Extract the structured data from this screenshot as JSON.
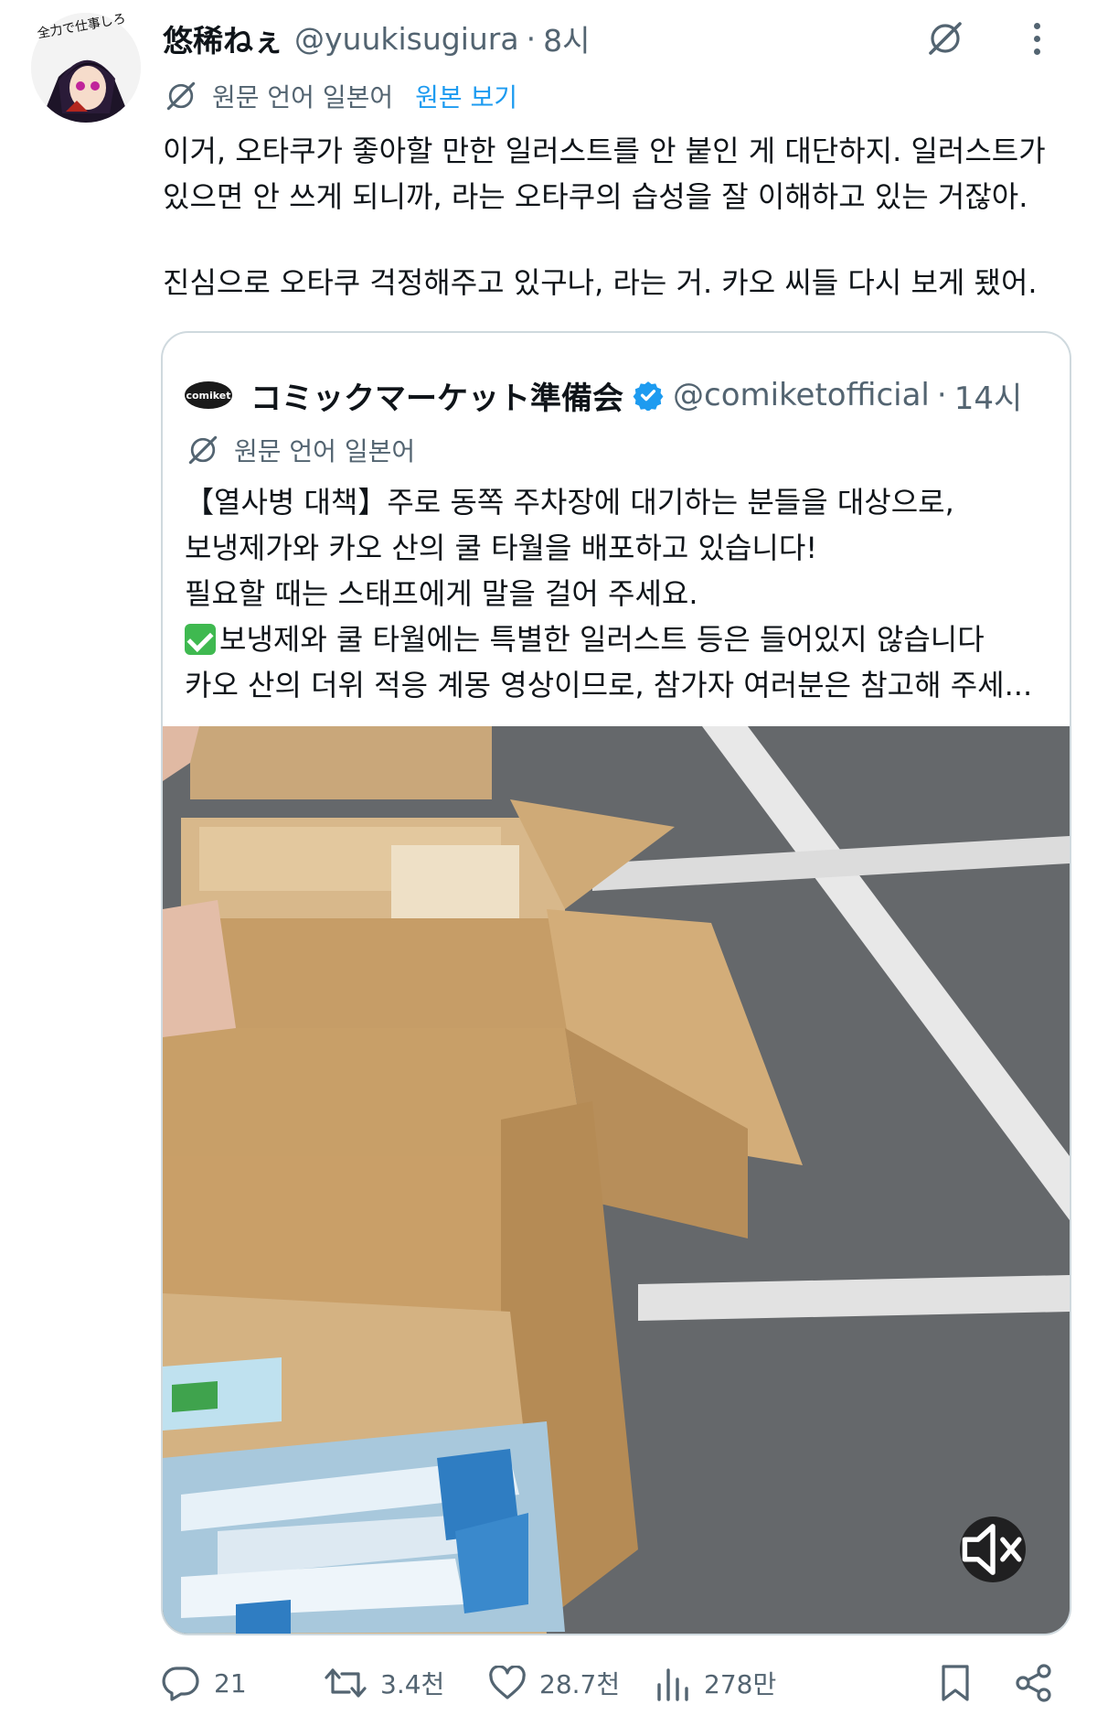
{
  "tweet": {
    "author_name": "悠稀ねぇ",
    "handle": "@yuukisugiura",
    "separator": "·",
    "time": "8시",
    "avatar_caption": "全力で仕事しろ",
    "translation_label": "원문 언어 일본어",
    "show_original": "원본 보기",
    "paragraphs": [
      "이거, 오타쿠가 좋아할 만한 일러스트를 안 붙인 게 대단하지. 일러스트가",
      "있으면 안 쓰게 되니까, 라는 오타쿠의 습성을 잘 이해하고 있는 거잖아.",
      "진심으로 오타쿠 걱정해주고 있구나, 라는 거. 카오 씨들 다시 보게 됐어."
    ]
  },
  "quote": {
    "logo_text": "comiket",
    "author_name": "コミックマーケット準備会",
    "handle": "@comiketofficial",
    "separator": "·",
    "time": "14시",
    "translation_label": "원문 언어 일본어",
    "lines": [
      "【열사병 대책】주로 동쪽 주차장에 대기하는 분들을 대상으로,",
      "보냉제가와 카오 산의 쿨 타월을 배포하고 있습니다!",
      "필요할 때는 스태프에게 말을 걸어 주세요.",
      "보냉제와 쿨 타월에는 특별한 일러스트 등은 들어있지 않습니다",
      "카오 산의 더위 적응 계몽 영상이므로, 참가자 여러분은 참고해 주세..."
    ]
  },
  "actions": {
    "replies": "21",
    "retweets": "3.4천",
    "likes": "28.7천",
    "views": "278만"
  },
  "colors": {
    "accent": "#1d9bf0",
    "secondary_text": "#536471",
    "border": "#cfd9de"
  },
  "icons": [
    "grok-icon",
    "more-icon",
    "translate-icon",
    "verified-icon",
    "mute-icon",
    "reply-icon",
    "retweet-icon",
    "like-icon",
    "views-icon",
    "bookmark-icon",
    "share-icon"
  ]
}
